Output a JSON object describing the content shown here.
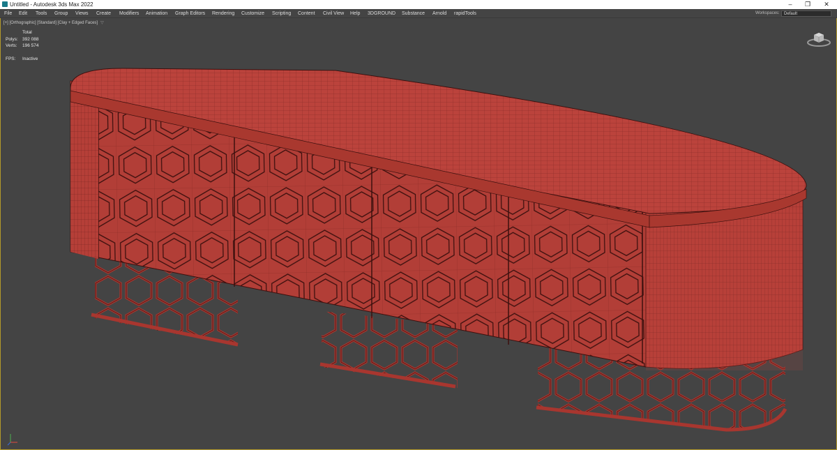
{
  "window": {
    "title": "Untitled - Autodesk 3ds Max 2022",
    "controls": [
      "–",
      "❐",
      "✕"
    ]
  },
  "menu": {
    "items": [
      "File",
      "Edit",
      "Tools",
      "Group",
      "Views",
      "Create",
      "Modifiers",
      "Animation",
      "Graph Editors",
      "Rendering",
      "Customize",
      "Scripting",
      "Content",
      "Civil View",
      "Help",
      "3DGROUND",
      "Substance",
      "Arnold",
      "rapidTools"
    ],
    "workspaces_label": "Workspaces:",
    "workspace_value": "Default"
  },
  "viewport": {
    "label": "[+] [Orthographic] [Standard] [Clay + Edged Faces]",
    "filter_icon": "funnel-icon",
    "stats": {
      "header": "Total",
      "polys_label": "Polys:",
      "polys_value": "392 088",
      "verts_label": "Verts:",
      "verts_value": "196 574",
      "fps_label": "FPS:",
      "fps_value": "Inactive"
    },
    "model": "sideboard-hexagon-pattern",
    "colors": {
      "background": "#444444",
      "clay": "#b8403a",
      "clay_dark": "#8f2c27",
      "wire": "#4a1512",
      "border_active": "#b49a2a"
    }
  }
}
